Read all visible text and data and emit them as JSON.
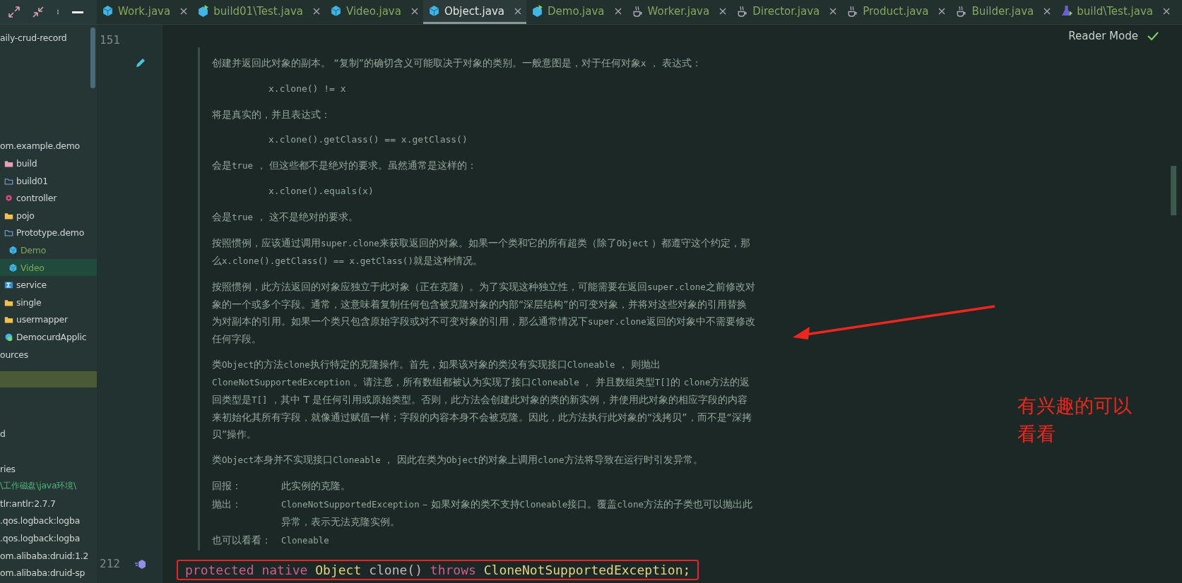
{
  "tabs": [
    {
      "label": "Work.java",
      "kind": "class",
      "selected": false
    },
    {
      "label": "build01\\Test.java",
      "kind": "runnable",
      "selected": false
    },
    {
      "label": "Video.java",
      "kind": "class",
      "selected": false
    },
    {
      "label": "Object.java",
      "kind": "class",
      "selected": true
    },
    {
      "label": "Demo.java",
      "kind": "runnable",
      "selected": false
    },
    {
      "label": "Worker.java",
      "kind": "java",
      "selected": false
    },
    {
      "label": "Director.java",
      "kind": "java",
      "selected": false
    },
    {
      "label": "Product.java",
      "kind": "java",
      "selected": false
    },
    {
      "label": "Builder.java",
      "kind": "java",
      "selected": false
    },
    {
      "label": "build\\Test.java",
      "kind": "test",
      "selected": false
    }
  ],
  "sidebar": {
    "title": "aily-crud-record",
    "tree": [
      {
        "label": "om.example.demo",
        "selected": false,
        "children": [
          {
            "label": "build",
            "kind": "module",
            "selected": false
          },
          {
            "label": "build01",
            "kind": "package",
            "selected": false
          },
          {
            "label": "controller",
            "kind": "web",
            "selected": false
          },
          {
            "label": "pojo",
            "kind": "folder",
            "selected": false
          },
          {
            "label": "Prototype.demo",
            "kind": "package",
            "selected": false,
            "children": [
              {
                "label": "Demo",
                "kind": "class",
                "selected": false
              },
              {
                "label": "Video",
                "kind": "class",
                "selected": true
              }
            ]
          },
          {
            "label": "service",
            "kind": "service",
            "selected": false
          },
          {
            "label": "single",
            "kind": "folder",
            "selected": false
          },
          {
            "label": "usermapper",
            "kind": "folder",
            "selected": false
          },
          {
            "label": "DemocurdApplic",
            "kind": "app",
            "selected": false
          }
        ]
      }
    ],
    "after_tree": "ources",
    "lower": [
      {
        "label": "d",
        "kind": "plain"
      },
      {
        "label": "ries",
        "kind": "plain"
      },
      {
        "label": "\\工作磁盘\\java环境\\",
        "kind": "path"
      },
      {
        "label": "tlr:antlr:2.7.7",
        "kind": "plain"
      },
      {
        "label": ".qos.logback:logba",
        "kind": "plain"
      },
      {
        "label": ".qos.logback:logba",
        "kind": "plain"
      },
      {
        "label": "om.alibaba:druid:1.2",
        "kind": "plain"
      },
      {
        "label": "om.alibaba:druid-sp",
        "kind": "plain"
      }
    ]
  },
  "gutter": {
    "line_numbers": [
      "151",
      "212"
    ]
  },
  "reader_mode": "Reader Mode",
  "doc": {
    "paragraphs": [
      {
        "kind": "prose",
        "parts": [
          {
            "kind": "text",
            "text": "创建并返回此对象的副本。 “复制”的确切含义可能取决于对象的类别。一般意图是，对于任何对象"
          },
          {
            "kind": "code",
            "text": "x"
          },
          {
            "kind": "text",
            "text": " ， 表达式："
          }
        ]
      },
      {
        "kind": "code",
        "text": "x.clone() != x"
      },
      {
        "kind": "prose",
        "parts": [
          {
            "kind": "text",
            "text": "将是真实的，并且表达式："
          }
        ]
      },
      {
        "kind": "code",
        "text": "x.clone().getClass() == x.getClass()"
      },
      {
        "kind": "prose",
        "parts": [
          {
            "kind": "text",
            "text": "会是"
          },
          {
            "kind": "code",
            "text": "true"
          },
          {
            "kind": "text",
            "text": " ， 但这些都不是绝对的要求。虽然通常是这样的："
          }
        ]
      },
      {
        "kind": "code",
        "text": "x.clone().equals(x)"
      },
      {
        "kind": "prose",
        "parts": [
          {
            "kind": "text",
            "text": "会是"
          },
          {
            "kind": "code",
            "text": "true"
          },
          {
            "kind": "text",
            "text": " ， 这不是绝对的要求。"
          }
        ]
      },
      {
        "kind": "prose",
        "parts": [
          {
            "kind": "text",
            "text": "按照惯例，应该通过调用"
          },
          {
            "kind": "code",
            "text": "super.clone"
          },
          {
            "kind": "text",
            "text": "来获取返回的对象。如果一个类和它的所有超类（除了"
          },
          {
            "kind": "code",
            "text": "Object"
          },
          {
            "kind": "text",
            "text": " ）都遵守这个约定，那么"
          },
          {
            "kind": "code",
            "text": "x.clone().getClass() == x.getClass()"
          },
          {
            "kind": "text",
            "text": "就是这种情况。"
          }
        ]
      },
      {
        "kind": "prose",
        "parts": [
          {
            "kind": "text",
            "text": "按照惯例，此方法返回的对象应独立于此对象（正在克隆）。为了实现这种独立性，可能需要在返回"
          },
          {
            "kind": "code",
            "text": "super.clone"
          },
          {
            "kind": "text",
            "text": "之前修改对象的一个或多个字段。通常，这意味着复制任何包含被克隆对象的内部“深层结构”的可变对象，并将对这些对象的引用替换为对副本的引用。如果一个类只包含原始字段或对不可变对象的引用，那么通常情况下"
          },
          {
            "kind": "code",
            "text": "super.clone"
          },
          {
            "kind": "text",
            "text": "返回的对象中不需要修改任何字段。"
          }
        ]
      },
      {
        "kind": "prose",
        "parts": [
          {
            "kind": "text",
            "text": "类"
          },
          {
            "kind": "code",
            "text": "Object"
          },
          {
            "kind": "text",
            "text": "的方法"
          },
          {
            "kind": "code",
            "text": "clone"
          },
          {
            "kind": "text",
            "text": "执行特定的克隆操作。首先，如果该对象的类没有实现接口"
          },
          {
            "kind": "code",
            "text": "Cloneable"
          },
          {
            "kind": "text",
            "text": " ， 则抛出 "
          },
          {
            "kind": "code",
            "text": "CloneNotSupportedException"
          },
          {
            "kind": "text",
            "text": " 。请注意，所有数组都被认为实现了接口"
          },
          {
            "kind": "code",
            "text": "Cloneable"
          },
          {
            "kind": "text",
            "text": " ， 并且数组类型"
          },
          {
            "kind": "code",
            "text": "T[]"
          },
          {
            "kind": "text",
            "text": "的 "
          },
          {
            "kind": "code",
            "text": "clone"
          },
          {
            "kind": "text",
            "text": "方法的返回类型是"
          },
          {
            "kind": "code",
            "text": "T[]"
          },
          {
            "kind": "text",
            "text": " ，其中 T 是任何引用或原始类型。否则，此方法会创建此对象的类的新实例，并使用此对象的相应字段的内容来初始化其所有字段，就像通过赋值一样；字段的内容本身不会被克隆。因此，此方法执行此对象的“浅拷贝”，而不是“深拷贝”操作。"
          }
        ]
      },
      {
        "kind": "prose",
        "parts": [
          {
            "kind": "text",
            "text": "类"
          },
          {
            "kind": "code",
            "text": "Object"
          },
          {
            "kind": "text",
            "text": "本身并不实现接口"
          },
          {
            "kind": "code",
            "text": "Cloneable"
          },
          {
            "kind": "text",
            "text": " ， 因此在类为"
          },
          {
            "kind": "code",
            "text": "Object"
          },
          {
            "kind": "text",
            "text": "的对象上调用"
          },
          {
            "kind": "code",
            "text": "clone"
          },
          {
            "kind": "text",
            "text": "方法将导致在运行时引发异常。"
          }
        ]
      }
    ],
    "tags": [
      {
        "label": "回报：",
        "parts": [
          {
            "kind": "text",
            "text": "此实例的克隆。"
          }
        ]
      },
      {
        "label": "抛出：",
        "parts": [
          {
            "kind": "code",
            "text": "CloneNotSupportedException"
          },
          {
            "kind": "text",
            "text": " – 如果对象的类不支持"
          },
          {
            "kind": "code",
            "text": "Cloneable"
          },
          {
            "kind": "text",
            "text": "接口。覆盖"
          },
          {
            "kind": "code",
            "text": "clone"
          },
          {
            "kind": "text",
            "text": "方法的子类也可以抛出此异常，表示无法克隆实例。"
          }
        ]
      },
      {
        "label": "也可以看看：",
        "parts": [
          {
            "kind": "code",
            "text": "Cloneable"
          }
        ]
      }
    ]
  },
  "code_line": [
    {
      "kind": "keyword",
      "text": "protected"
    },
    {
      "kind": "keyword",
      "text": "native"
    },
    {
      "kind": "type",
      "text": "Object"
    },
    {
      "kind": "method",
      "text": "clone()"
    },
    {
      "kind": "keyword",
      "text": "throws"
    },
    {
      "kind": "type",
      "text": "CloneNotSupportedException;"
    }
  ],
  "annotation": {
    "note": "有兴趣的可以看看"
  }
}
